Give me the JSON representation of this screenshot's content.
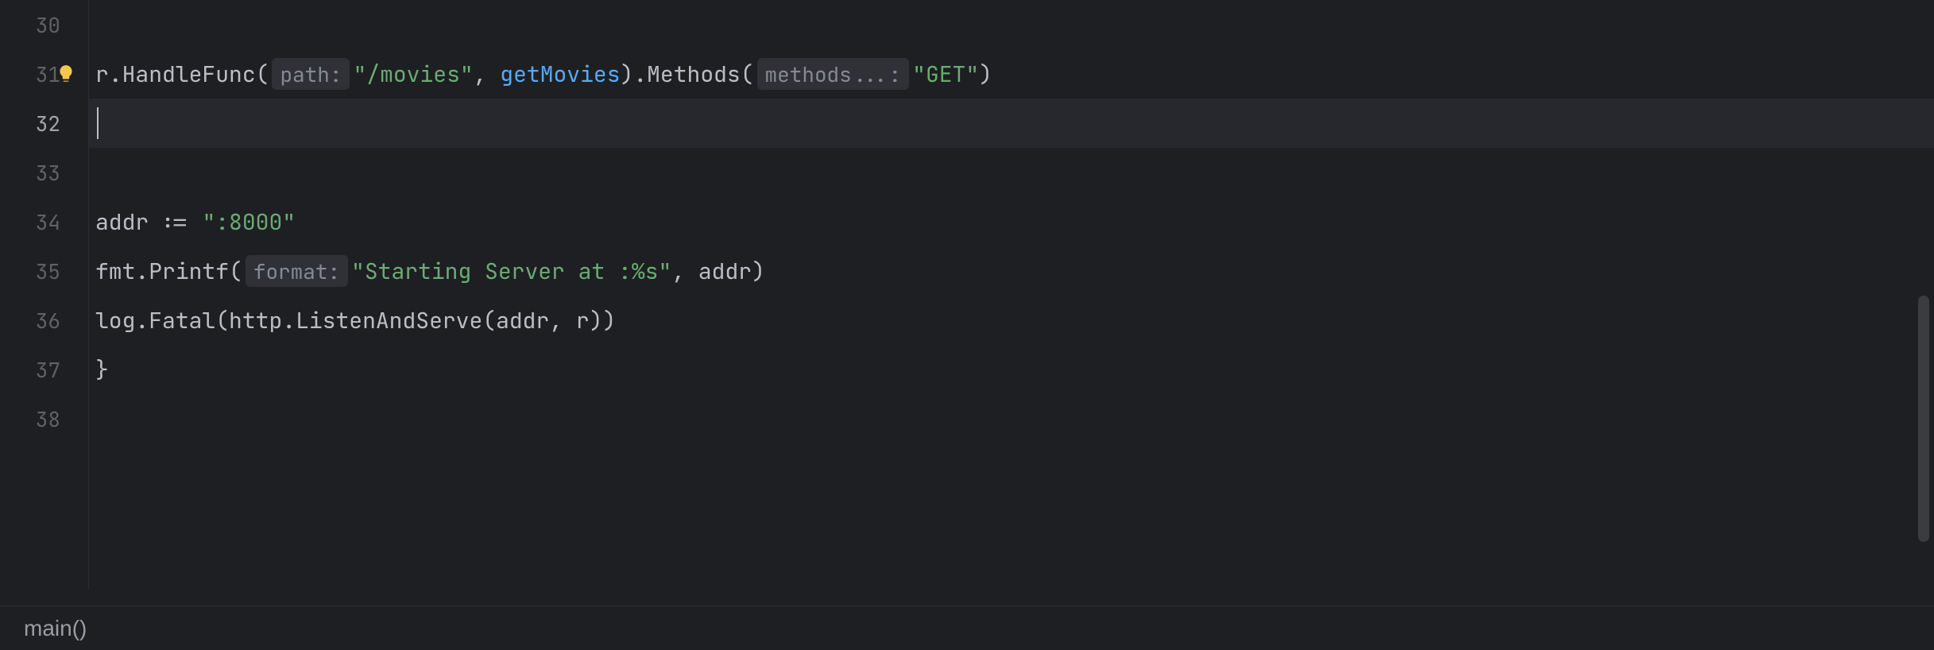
{
  "gutter": {
    "lines": [
      "30",
      "31",
      "32",
      "33",
      "34",
      "35",
      "36",
      "37",
      "38"
    ],
    "active_index": 2
  },
  "code": {
    "line31": {
      "r": "r",
      "dot1": ".",
      "handlefunc": "HandleFunc",
      "lp1": "(",
      "hint_path": "path:",
      "str_movies": "\"/movies\"",
      "comma1": ",",
      "sp1": " ",
      "getmovies": "getMovies",
      "rp1": ")",
      "dot2": ".",
      "methods": "Methods",
      "lp2": "(",
      "hint_methods": "methods...:",
      "str_get": "\"GET\"",
      "rp2": ")"
    },
    "line34": {
      "addr": "addr",
      "sp1": " ",
      "assign": ":=",
      "sp2": " ",
      "str_port": "\":8000\""
    },
    "line35": {
      "fmt": "fmt",
      "dot": ".",
      "printf": "Printf",
      "lp": "(",
      "hint_format": "format:",
      "str_msg": "\"Starting Server at :%s\"",
      "comma": ",",
      "sp": " ",
      "addr": "addr",
      "rp": ")"
    },
    "line36": {
      "log": "log",
      "dot1": ".",
      "fatal": "Fatal",
      "lp1": "(",
      "http": "http",
      "dot2": ".",
      "listen": "ListenAndServe",
      "lp2": "(",
      "addr": "addr",
      "comma": ",",
      "sp": " ",
      "r": "r",
      "rp2": ")",
      "rp1": ")"
    },
    "line37": {
      "brace": "}"
    }
  },
  "breadcrumb": {
    "label": "main()"
  },
  "icons": {
    "bulb": "bulb-icon"
  }
}
